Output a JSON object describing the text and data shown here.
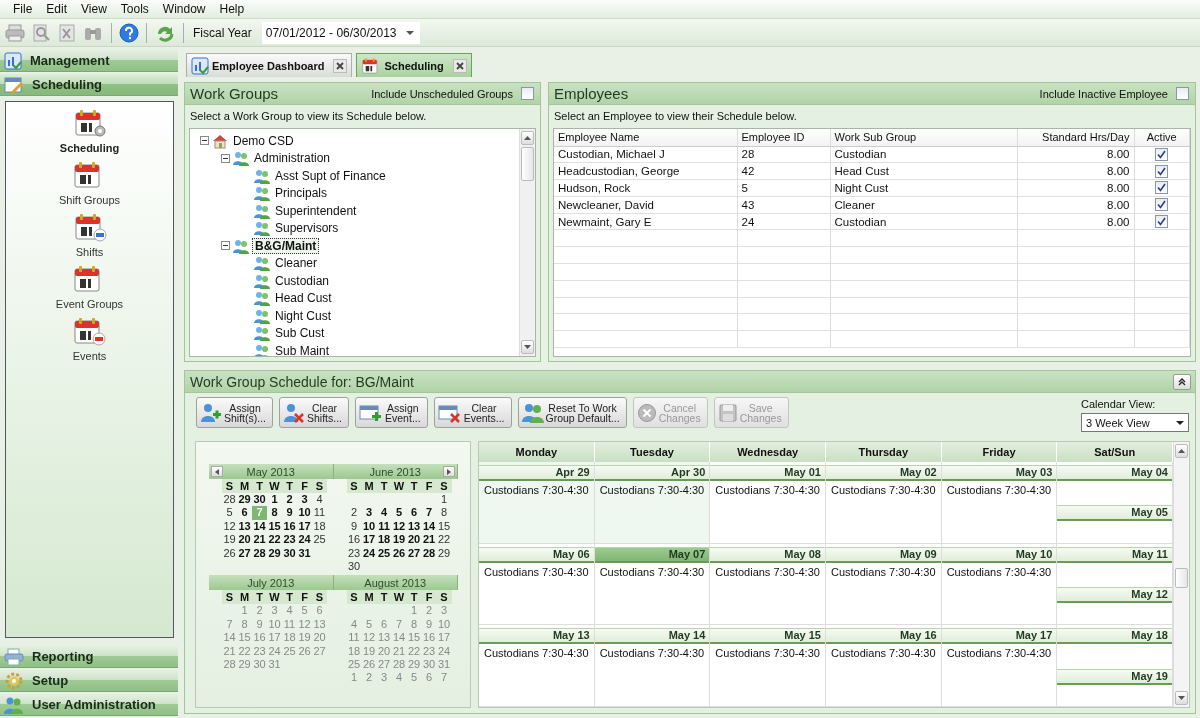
{
  "menu": [
    "File",
    "Edit",
    "View",
    "Tools",
    "Window",
    "Help"
  ],
  "toolbar": {
    "fiscal_year_label": "Fiscal Year",
    "fiscal_year": "07/01/2012 - 06/30/2013"
  },
  "sidebar": {
    "sections": [
      {
        "label": "Management",
        "expanded": false
      },
      {
        "label": "Scheduling",
        "expanded": true,
        "items": [
          {
            "label": "Scheduling",
            "selected": true
          },
          {
            "label": "Shift Groups",
            "selected": false
          },
          {
            "label": "Shifts",
            "selected": false
          },
          {
            "label": "Event Groups",
            "selected": false
          },
          {
            "label": "Events",
            "selected": false
          }
        ]
      },
      {
        "label": "Reporting",
        "expanded": false
      },
      {
        "label": "Setup",
        "expanded": false
      },
      {
        "label": "User Administration",
        "expanded": false
      }
    ]
  },
  "tabs": [
    {
      "label": "Employee Dashboard",
      "selected": false
    },
    {
      "label": "Scheduling",
      "selected": true
    }
  ],
  "work_groups": {
    "title": "Work Groups",
    "option_label": "Include Unscheduled Groups",
    "option_checked": false,
    "hint": "Select a Work Group to view its Schedule below.",
    "tree": [
      {
        "label": "Demo CSD",
        "expanded": true,
        "selected": false,
        "children": [
          {
            "label": "Administration",
            "expanded": true,
            "selected": false,
            "children": [
              {
                "label": "Asst Supt of Finance",
                "selected": false
              },
              {
                "label": "Principals",
                "selected": false
              },
              {
                "label": "Superintendent",
                "selected": false
              },
              {
                "label": "Supervisors",
                "selected": false
              }
            ]
          },
          {
            "label": "B&G/Maint",
            "expanded": true,
            "selected": true,
            "children": [
              {
                "label": "Cleaner",
                "selected": false
              },
              {
                "label": "Custodian",
                "selected": false
              },
              {
                "label": "Head Cust",
                "selected": false
              },
              {
                "label": "Night Cust",
                "selected": false
              },
              {
                "label": "Sub Cust",
                "selected": false
              },
              {
                "label": "Sub Maint",
                "selected": false
              }
            ]
          }
        ]
      }
    ]
  },
  "employees": {
    "title": "Employees",
    "option_label": "Include Inactive Employee",
    "option_checked": false,
    "hint": "Select an Employee to view their Schedule below.",
    "columns": [
      "Employee Name",
      "Employee ID",
      "Work Sub Group",
      "Standard Hrs/Day",
      "Active"
    ],
    "rows": [
      {
        "name": "Custodian, Michael J",
        "id": "28",
        "sub_group": "Custodian",
        "hours": "8.00",
        "active": true
      },
      {
        "name": "Headcustodian, George",
        "id": "42",
        "sub_group": "Head Cust",
        "hours": "8.00",
        "active": true
      },
      {
        "name": "Hudson, Rock",
        "id": "5",
        "sub_group": "Night Cust",
        "hours": "8.00",
        "active": true
      },
      {
        "name": "Newcleaner, David",
        "id": "43",
        "sub_group": "Cleaner",
        "hours": "8.00",
        "active": true
      },
      {
        "name": "Newmaint, Gary E",
        "id": "24",
        "sub_group": "Custodian",
        "hours": "8.00",
        "active": true
      }
    ]
  },
  "schedule": {
    "title": "Work Group Schedule for:",
    "group": "BG/Maint",
    "buttons": [
      {
        "label": "Assign\nShift(s)...",
        "disabled": false
      },
      {
        "label": "Clear\nShifts...",
        "disabled": false
      },
      {
        "label": "Assign\nEvent...",
        "disabled": false
      },
      {
        "label": "Clear\nEvents...",
        "disabled": false
      },
      {
        "label": "Reset To Work\nGroup Default...",
        "disabled": false
      },
      {
        "label": "Cancel\nChanges",
        "disabled": true
      },
      {
        "label": "Save\nChanges",
        "disabled": true
      }
    ],
    "calendar_view_label": "Calendar View:",
    "calendar_view": "3 Week View",
    "months": [
      {
        "title": "May 2013",
        "muted": false,
        "weekdays": [
          "S",
          "M",
          "T",
          "W",
          "T",
          "F",
          "S"
        ],
        "weeks": [
          [
            {
              "day": "28",
              "bold": false,
              "selected": false
            },
            {
              "day": "29",
              "bold": true,
              "selected": false
            },
            {
              "day": "30",
              "bold": true,
              "selected": false
            },
            {
              "day": "1",
              "bold": true,
              "selected": false
            },
            {
              "day": "2",
              "bold": true,
              "selected": false
            },
            {
              "day": "3",
              "bold": true,
              "selected": false
            },
            {
              "day": "4",
              "bold": false,
              "selected": false
            }
          ],
          [
            {
              "day": "5",
              "bold": false,
              "selected": false
            },
            {
              "day": "6",
              "bold": true,
              "selected": false
            },
            {
              "day": "7",
              "bold": true,
              "selected": true
            },
            {
              "day": "8",
              "bold": true,
              "selected": false
            },
            {
              "day": "9",
              "bold": true,
              "selected": false
            },
            {
              "day": "10",
              "bold": true,
              "selected": false
            },
            {
              "day": "11",
              "bold": false,
              "selected": false
            }
          ],
          [
            {
              "day": "12",
              "bold": false,
              "selected": false
            },
            {
              "day": "13",
              "bold": true,
              "selected": false
            },
            {
              "day": "14",
              "bold": true,
              "selected": false
            },
            {
              "day": "15",
              "bold": true,
              "selected": false
            },
            {
              "day": "16",
              "bold": true,
              "selected": false
            },
            {
              "day": "17",
              "bold": true,
              "selected": false
            },
            {
              "day": "18",
              "bold": false,
              "selected": false
            }
          ],
          [
            {
              "day": "19",
              "bold": false,
              "selected": false
            },
            {
              "day": "20",
              "bold": true,
              "selected": false
            },
            {
              "day": "21",
              "bold": true,
              "selected": false
            },
            {
              "day": "22",
              "bold": true,
              "selected": false
            },
            {
              "day": "23",
              "bold": true,
              "selected": false
            },
            {
              "day": "24",
              "bold": true,
              "selected": false
            },
            {
              "day": "25",
              "bold": false,
              "selected": false
            }
          ],
          [
            {
              "day": "26",
              "bold": false,
              "selected": false
            },
            {
              "day": "27",
              "bold": true,
              "selected": false
            },
            {
              "day": "28",
              "bold": true,
              "selected": false
            },
            {
              "day": "29",
              "bold": true,
              "selected": false
            },
            {
              "day": "30",
              "bold": true,
              "selected": false
            },
            {
              "day": "31",
              "bold": true,
              "selected": false
            }
          ]
        ]
      },
      {
        "title": "June 2013",
        "muted": false,
        "weekdays": [
          "S",
          "M",
          "T",
          "W",
          "T",
          "F",
          "S"
        ],
        "weeks": [
          [
            {
              "day": "1",
              "bold": false,
              "selected": false
            }
          ],
          [
            {
              "day": "2",
              "bold": false,
              "selected": false
            },
            {
              "day": "3",
              "bold": true,
              "selected": false
            },
            {
              "day": "4",
              "bold": true,
              "selected": false
            },
            {
              "day": "5",
              "bold": true,
              "selected": false
            },
            {
              "day": "6",
              "bold": true,
              "selected": false
            },
            {
              "day": "7",
              "bold": true,
              "selected": false
            },
            {
              "day": "8",
              "bold": false,
              "selected": false
            }
          ],
          [
            {
              "day": "9",
              "bold": false,
              "selected": false
            },
            {
              "day": "10",
              "bold": true,
              "selected": false
            },
            {
              "day": "11",
              "bold": true,
              "selected": false
            },
            {
              "day": "12",
              "bold": true,
              "selected": false
            },
            {
              "day": "13",
              "bold": true,
              "selected": false
            },
            {
              "day": "14",
              "bold": true,
              "selected": false
            },
            {
              "day": "15",
              "bold": false,
              "selected": false
            }
          ],
          [
            {
              "day": "16",
              "bold": false,
              "selected": false
            },
            {
              "day": "17",
              "bold": true,
              "selected": false
            },
            {
              "day": "18",
              "bold": true,
              "selected": false
            },
            {
              "day": "19",
              "bold": true,
              "selected": false
            },
            {
              "day": "20",
              "bold": true,
              "selected": false
            },
            {
              "day": "21",
              "bold": true,
              "selected": false
            },
            {
              "day": "22",
              "bold": false,
              "selected": false
            }
          ],
          [
            {
              "day": "23",
              "bold": false,
              "selected": false
            },
            {
              "day": "24",
              "bold": true,
              "selected": false
            },
            {
              "day": "25",
              "bold": true,
              "selected": false
            },
            {
              "day": "26",
              "bold": true,
              "selected": false
            },
            {
              "day": "27",
              "bold": true,
              "selected": false
            },
            {
              "day": "28",
              "bold": true,
              "selected": false
            },
            {
              "day": "29",
              "bold": false,
              "selected": false
            }
          ],
          [
            {
              "day": "30",
              "bold": false,
              "selected": false
            }
          ]
        ]
      },
      {
        "title": "July 2013",
        "muted": true,
        "weekdays": [
          "S",
          "M",
          "T",
          "W",
          "T",
          "F",
          "S"
        ],
        "weeks": [
          [
            {
              "day": "1",
              "bold": false,
              "selected": false
            },
            {
              "day": "2",
              "bold": false,
              "selected": false
            },
            {
              "day": "3",
              "bold": false,
              "selected": false
            },
            {
              "day": "4",
              "bold": false,
              "selected": false
            },
            {
              "day": "5",
              "bold": false,
              "selected": false
            },
            {
              "day": "6",
              "bold": false,
              "selected": false
            }
          ],
          [
            {
              "day": "7",
              "bold": false,
              "selected": false
            },
            {
              "day": "8",
              "bold": false,
              "selected": false
            },
            {
              "day": "9",
              "bold": false,
              "selected": false
            },
            {
              "day": "10",
              "bold": false,
              "selected": false
            },
            {
              "day": "11",
              "bold": false,
              "selected": false
            },
            {
              "day": "12",
              "bold": false,
              "selected": false
            },
            {
              "day": "13",
              "bold": false,
              "selected": false
            }
          ],
          [
            {
              "day": "14",
              "bold": false,
              "selected": false
            },
            {
              "day": "15",
              "bold": false,
              "selected": false
            },
            {
              "day": "16",
              "bold": false,
              "selected": false
            },
            {
              "day": "17",
              "bold": false,
              "selected": false
            },
            {
              "day": "18",
              "bold": false,
              "selected": false
            },
            {
              "day": "19",
              "bold": false,
              "selected": false
            },
            {
              "day": "20",
              "bold": false,
              "selected": false
            }
          ],
          [
            {
              "day": "21",
              "bold": false,
              "selected": false
            },
            {
              "day": "22",
              "bold": false,
              "selected": false
            },
            {
              "day": "23",
              "bold": false,
              "selected": false
            },
            {
              "day": "24",
              "bold": false,
              "selected": false
            },
            {
              "day": "25",
              "bold": false,
              "selected": false
            },
            {
              "day": "26",
              "bold": false,
              "selected": false
            },
            {
              "day": "27",
              "bold": false,
              "selected": false
            }
          ],
          [
            {
              "day": "28",
              "bold": false,
              "selected": false
            },
            {
              "day": "29",
              "bold": false,
              "selected": false
            },
            {
              "day": "30",
              "bold": false,
              "selected": false
            },
            {
              "day": "31",
              "bold": false,
              "selected": false
            }
          ]
        ]
      },
      {
        "title": "August 2013",
        "muted": true,
        "weekdays": [
          "S",
          "M",
          "T",
          "W",
          "T",
          "F",
          "S"
        ],
        "weeks": [
          [
            {
              "day": "1",
              "bold": false,
              "selected": false
            },
            {
              "day": "2",
              "bold": false,
              "selected": false
            },
            {
              "day": "3",
              "bold": false,
              "selected": false
            }
          ],
          [
            {
              "day": "4",
              "bold": false,
              "selected": false
            },
            {
              "day": "5",
              "bold": false,
              "selected": false
            },
            {
              "day": "6",
              "bold": false,
              "selected": false
            },
            {
              "day": "7",
              "bold": false,
              "selected": false
            },
            {
              "day": "8",
              "bold": false,
              "selected": false
            },
            {
              "day": "9",
              "bold": false,
              "selected": false
            },
            {
              "day": "10",
              "bold": false,
              "selected": false
            }
          ],
          [
            {
              "day": "11",
              "bold": false,
              "selected": false
            },
            {
              "day": "12",
              "bold": false,
              "selected": false
            },
            {
              "day": "13",
              "bold": false,
              "selected": false
            },
            {
              "day": "14",
              "bold": false,
              "selected": false
            },
            {
              "day": "15",
              "bold": false,
              "selected": false
            },
            {
              "day": "16",
              "bold": false,
              "selected": false
            },
            {
              "day": "17",
              "bold": false,
              "selected": false
            }
          ],
          [
            {
              "day": "18",
              "bold": false,
              "selected": false
            },
            {
              "day": "19",
              "bold": false,
              "selected": false
            },
            {
              "day": "20",
              "bold": false,
              "selected": false
            },
            {
              "day": "21",
              "bold": false,
              "selected": false
            },
            {
              "day": "22",
              "bold": false,
              "selected": false
            },
            {
              "day": "23",
              "bold": false,
              "selected": false
            },
            {
              "day": "24",
              "bold": false,
              "selected": false
            }
          ],
          [
            {
              "day": "25",
              "bold": false,
              "selected": false
            },
            {
              "day": "26",
              "bold": false,
              "selected": false
            },
            {
              "day": "27",
              "bold": false,
              "selected": false
            },
            {
              "day": "28",
              "bold": false,
              "selected": false
            },
            {
              "day": "29",
              "bold": false,
              "selected": false
            },
            {
              "day": "30",
              "bold": false,
              "selected": false
            },
            {
              "day": "31",
              "bold": false,
              "selected": false
            }
          ],
          [
            {
              "day": "1",
              "bold": false,
              "selected": false
            },
            {
              "day": "2",
              "bold": false,
              "selected": false
            },
            {
              "day": "3",
              "bold": false,
              "selected": false
            },
            {
              "day": "4",
              "bold": false,
              "selected": false
            },
            {
              "day": "5",
              "bold": false,
              "selected": false
            },
            {
              "day": "6",
              "bold": false,
              "selected": false
            },
            {
              "day": "7",
              "bold": false,
              "selected": false
            }
          ]
        ]
      }
    ],
    "day_columns": [
      "Monday",
      "Tuesday",
      "Wednesday",
      "Thursday",
      "Friday",
      "Sat/Sun"
    ],
    "weeks": [
      {
        "days": [
          {
            "date": "Apr 29",
            "selected": false,
            "shaded": true,
            "entries": [
              "Custodians 7:30-4:30"
            ]
          },
          {
            "date": "Apr 30",
            "selected": false,
            "shaded": true,
            "entries": [
              "Custodians 7:30-4:30"
            ]
          },
          {
            "date": "May 01",
            "selected": false,
            "shaded": false,
            "entries": [
              "Custodians 7:30-4:30"
            ]
          },
          {
            "date": "May 02",
            "selected": false,
            "shaded": false,
            "entries": [
              "Custodians 7:30-4:30"
            ]
          },
          {
            "date": "May 03",
            "selected": false,
            "shaded": false,
            "entries": [
              "Custodians 7:30-4:30"
            ]
          },
          {
            "date": "May 04",
            "selected": false,
            "shaded": false
          },
          {
            "date": "May 05",
            "selected": false,
            "shaded": false
          }
        ]
      },
      {
        "days": [
          {
            "date": "May 06",
            "selected": false,
            "shaded": false,
            "entries": [
              "Custodians 7:30-4:30"
            ]
          },
          {
            "date": "May 07",
            "selected": true,
            "shaded": false,
            "entries": [
              "Custodians 7:30-4:30"
            ]
          },
          {
            "date": "May 08",
            "selected": false,
            "shaded": false,
            "entries": [
              "Custodians 7:30-4:30"
            ]
          },
          {
            "date": "May 09",
            "selected": false,
            "shaded": false,
            "entries": [
              "Custodians 7:30-4:30"
            ]
          },
          {
            "date": "May 10",
            "selected": false,
            "shaded": false,
            "entries": [
              "Custodians 7:30-4:30"
            ]
          },
          {
            "date": "May 11",
            "selected": false,
            "shaded": false
          },
          {
            "date": "May 12",
            "selected": false,
            "shaded": false
          }
        ]
      },
      {
        "days": [
          {
            "date": "May 13",
            "selected": false,
            "shaded": false,
            "entries": [
              "Custodians 7:30-4:30"
            ]
          },
          {
            "date": "May 14",
            "selected": false,
            "shaded": false,
            "entries": [
              "Custodians 7:30-4:30"
            ]
          },
          {
            "date": "May 15",
            "selected": false,
            "shaded": false,
            "entries": [
              "Custodians 7:30-4:30"
            ]
          },
          {
            "date": "May 16",
            "selected": false,
            "shaded": false,
            "entries": [
              "Custodians 7:30-4:30"
            ]
          },
          {
            "date": "May 17",
            "selected": false,
            "shaded": false,
            "entries": [
              "Custodians 7:30-4:30"
            ]
          },
          {
            "date": "May 18",
            "selected": false,
            "shaded": false
          },
          {
            "date": "May 19",
            "selected": false,
            "shaded": false
          }
        ]
      }
    ]
  }
}
